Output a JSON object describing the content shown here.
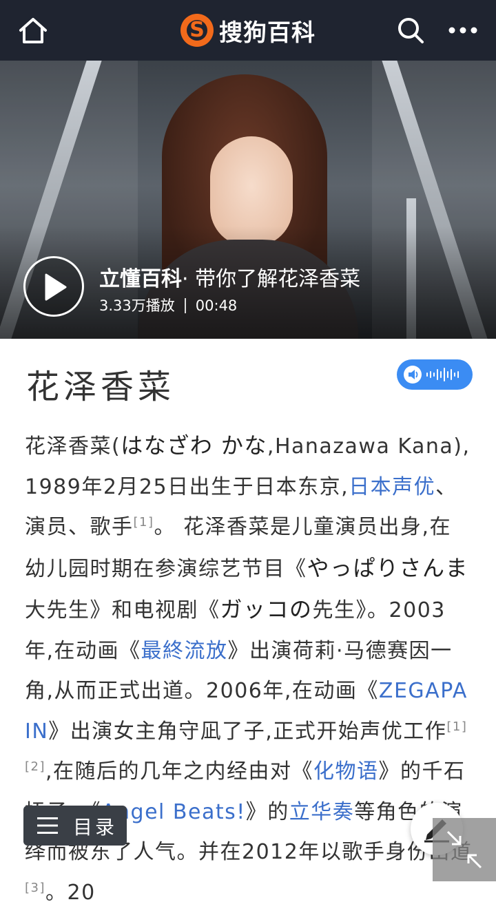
{
  "header": {
    "app_name": "搜狗百科",
    "home_icon": "home-icon",
    "search_icon": "search-icon",
    "more_icon": "more-icon",
    "bar_color": "#1f2430",
    "logo_color": "#f26a1b"
  },
  "video": {
    "brand": "立懂百科",
    "title_rest": "· 带你了解花泽香菜",
    "plays": "3.33万播放",
    "duration": "00:48",
    "play_icon": "play-icon"
  },
  "entry": {
    "title": "花泽香菜",
    "audio_button_icon": "speaker-waveform-icon",
    "accent": "#3b8cf3"
  },
  "article": {
    "p1_a": "花泽香菜(",
    "p1_jp1": "はなざわ かな",
    "p1_b": ",Hanazawa Kana),1989年2月25日出生于日本东京,",
    "link_seiyuu": "日本声优",
    "p1_c": "、演员、歌手",
    "ref1": "[1]",
    "p1_d": "。 花泽香菜是儿童演员出身,在幼儿园时期在参演综艺节目《",
    "p1_jp2": "やっぱりさんま",
    "p1_e": "大先生》和电视剧《",
    "p1_jp3": "ガッコの",
    "p1_f": "先生》。2003年,在动画《",
    "link_ergo": "最終流放",
    "p1_g": "》出演荷莉·马德赛因一角,从而正式出道。2006年,在动画《",
    "link_zega": "ZEGAPAIN",
    "p1_h": "》出演女主角守凪了子,正式开始声优工作",
    "ref2": "[1]",
    "ref3": "[2]",
    "p1_i": ",在随后的几年之内经由对《",
    "link_bake": "化物语",
    "p1_j": "》的千石抚子、《",
    "link_ab": "Angel Beats!",
    "p1_k": "》的",
    "link_kanade": "立华奏",
    "p1_l": "等角色的演绎而被东",
    "p1_m": "了人气。并在2012年以歌手身份出道",
    "ref4": "[3]",
    "p1_n": "。20"
  },
  "controls": {
    "toc_label": "目录",
    "toc_icon": "menu-icon",
    "edit_icon": "pencil-icon",
    "expand_icon": "collapse-arrows-icon"
  }
}
